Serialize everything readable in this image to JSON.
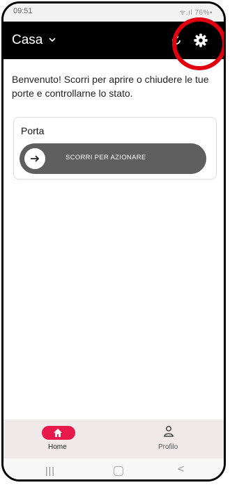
{
  "status": {
    "time": "09:51",
    "right": "ᯤ.ıl 76%▪"
  },
  "appbar": {
    "title": "Casa",
    "icons": [
      "chevron-down-icon",
      "refresh-icon",
      "gear-icon"
    ]
  },
  "main": {
    "welcome": "Benvenuto! Scorri per aprire o chiudere le tue porte e controllarne lo stato."
  },
  "card": {
    "title": "Porta",
    "slider_label": "SCORRI PER AZIONARE",
    "slider_icon": "arrow-right-icon"
  },
  "bottom_nav": [
    {
      "label": "Home",
      "icon": "home-icon",
      "active": true
    },
    {
      "label": "Profilo",
      "icon": "user-icon",
      "active": false
    }
  ],
  "system_nav": {
    "recent": "|||",
    "back": "<"
  },
  "colors": {
    "appbar": "#000000",
    "accent": "#e81a4b",
    "highlight_ring": "#e00010",
    "slider": "#5f5f5f"
  }
}
